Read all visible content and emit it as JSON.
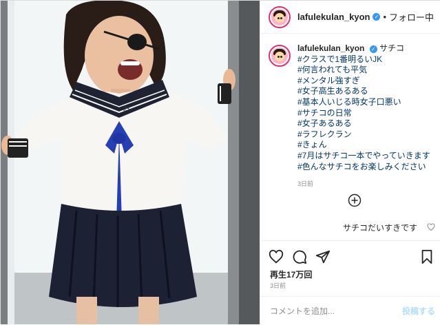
{
  "header": {
    "username": "lafulekulan_kyon",
    "separator": "•",
    "follow_status": "フォロー中"
  },
  "caption": {
    "username": "lafulekulan_kyon",
    "title": "サチコ",
    "hashtags": [
      "#クラスで1番明るいJK",
      "#何言われても平気",
      "#メンタル強すぎ",
      "#女子高生あるある",
      "#基本人いじる時女子口悪い",
      "#サチコの日常",
      "#女子あるある",
      "#ラフレクラン",
      "#きょん",
      "#7月はサチコ一本でやっていきます",
      "#色んなサチコをお楽しみください"
    ],
    "time": "3日前"
  },
  "comment": {
    "text": "サチコだいすきです"
  },
  "stats": {
    "views": "再生17万回",
    "age": "3日前"
  },
  "add_comment": {
    "placeholder": "コメントを追加...",
    "post_label": "投稿する"
  },
  "icons": {
    "verified": "verified-badge-icon",
    "load_more": "plus-circle-icon",
    "like": "heart-icon",
    "comment": "comment-bubble-icon",
    "share": "paper-plane-icon",
    "save": "bookmark-icon"
  },
  "colors": {
    "verified": "#3897f0",
    "hashtag": "#00376b",
    "post_button_disabled": "#b2dffc",
    "avatar_ring": "#e1306c"
  }
}
